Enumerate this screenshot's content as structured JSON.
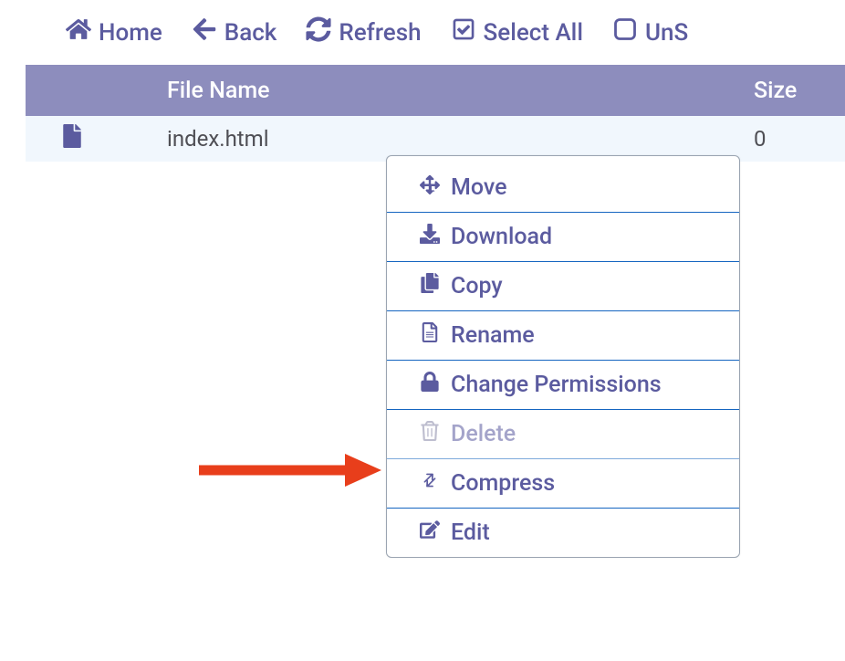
{
  "toolbar": {
    "home": "Home",
    "back": "Back",
    "refresh": "Refresh",
    "select_all": "Select All",
    "unselect": "UnS"
  },
  "table": {
    "header": {
      "file_name": "File Name",
      "size": "Size"
    },
    "rows": [
      {
        "name": "index.html",
        "size": "0"
      }
    ]
  },
  "context_menu": {
    "move": "Move",
    "download": "Download",
    "copy": "Copy",
    "rename": "Rename",
    "change_permissions": "Change Permissions",
    "delete": "Delete",
    "compress": "Compress",
    "edit": "Edit"
  }
}
